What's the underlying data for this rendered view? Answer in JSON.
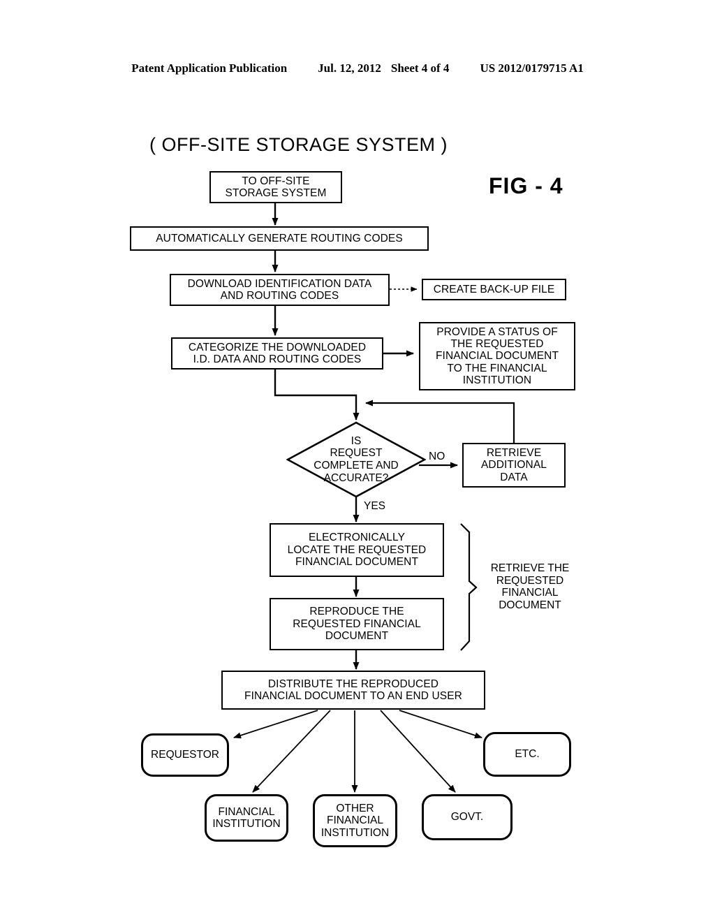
{
  "header": {
    "publication": "Patent Application Publication",
    "date": "Jul. 12, 2012",
    "sheet": "Sheet 4 of 4",
    "patent_number": "US 2012/0179715 A1"
  },
  "figure": {
    "title": "( OFF-SITE STORAGE SYSTEM )",
    "label": "FIG - 4"
  },
  "nodes": {
    "to_offsite": "TO OFF-SITE\nSTORAGE SYSTEM",
    "generate_routing": "AUTOMATICALLY GENERATE ROUTING CODES",
    "download_id": "DOWNLOAD IDENTIFICATION DATA\nAND ROUTING CODES",
    "create_backup": "CREATE BACK-UP FILE",
    "categorize": "CATEGORIZE THE DOWNLOADED\nI.D. DATA AND ROUTING CODES",
    "provide_status": "PROVIDE A STATUS OF\nTHE REQUESTED\nFINANCIAL DOCUMENT\nTO THE FINANCIAL\nINSTITUTION",
    "decision": "IS\nREQUEST\nCOMPLETE AND\nACCURATE?",
    "retrieve_additional": "RETRIEVE\nADDITIONAL\nDATA",
    "electronically_locate": "ELECTRONICALLY\nLOCATE THE REQUESTED\nFINANCIAL DOCUMENT",
    "reproduce": "REPRODUCE THE\nREQUESTED FINANCIAL\nDOCUMENT",
    "distribute": "DISTRIBUTE THE REPRODUCED\nFINANCIAL DOCUMENT TO AN END USER"
  },
  "brace_group": {
    "label": "RETRIEVE THE\nREQUESTED\nFINANCIAL\nDOCUMENT"
  },
  "edge_labels": {
    "no": "NO",
    "yes": "YES"
  },
  "terminals": [
    {
      "id": "requestor",
      "label": "REQUESTOR"
    },
    {
      "id": "financial-institution",
      "label": "FINANCIAL\nINSTITUTION"
    },
    {
      "id": "other-financial-institution",
      "label": "OTHER\nFINANCIAL\nINSTITUTION"
    },
    {
      "id": "govt",
      "label": "GOVT."
    },
    {
      "id": "etc",
      "label": "ETC."
    }
  ],
  "colors": {
    "ink": "#000000",
    "paper": "#ffffff"
  }
}
